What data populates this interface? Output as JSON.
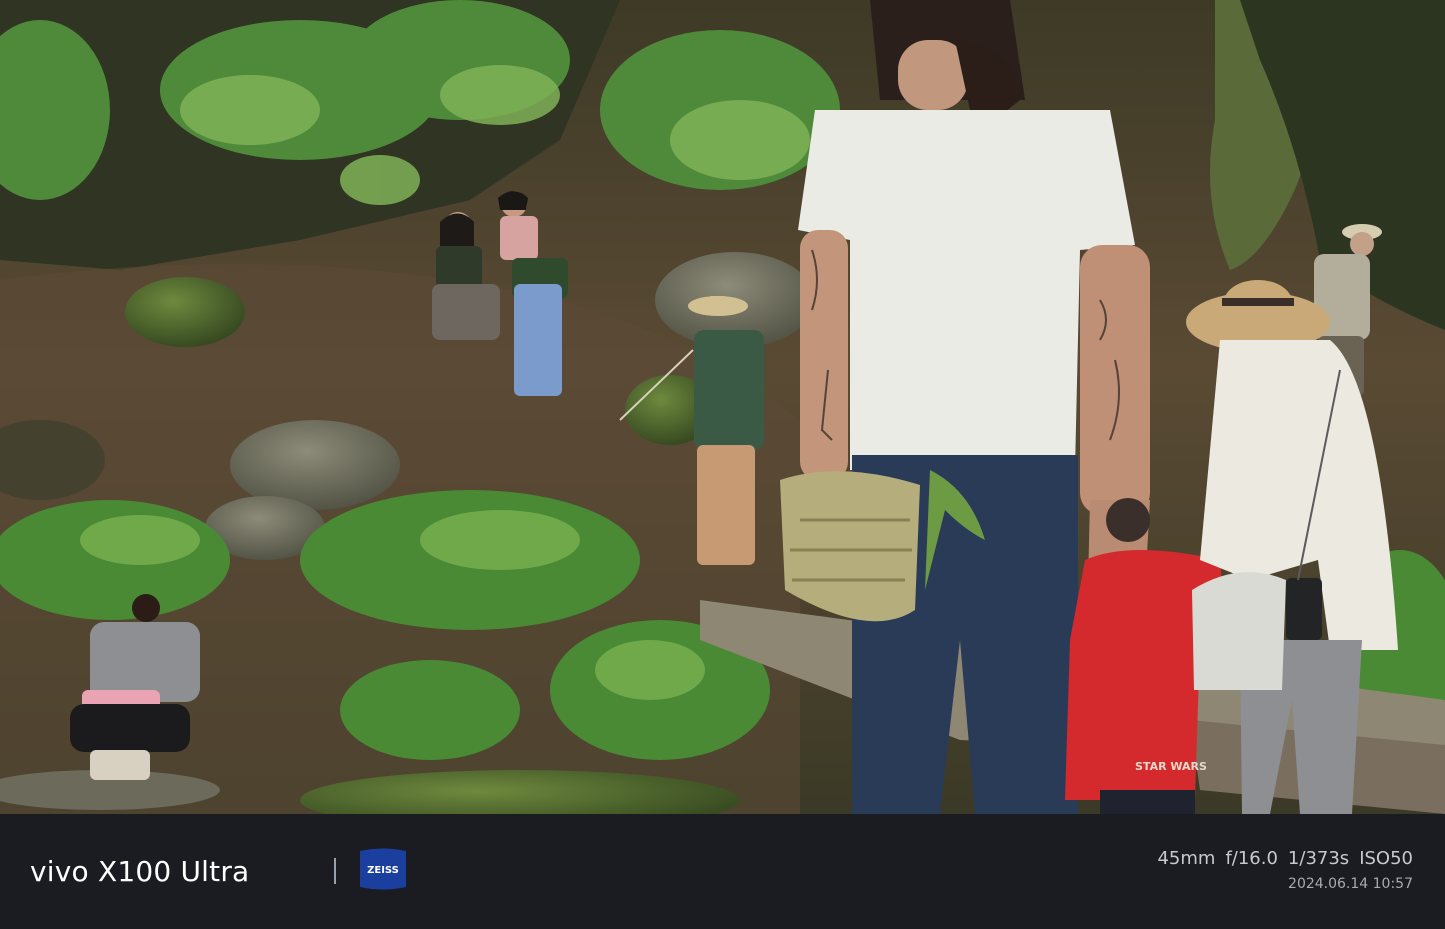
{
  "footer": {
    "brand": "vivo X100 Ultra",
    "partner_logo": {
      "text": "ZEISS",
      "color": "#1b3f9e"
    },
    "exif": {
      "focal_length": "45mm",
      "aperture": "f/16.0",
      "shutter": "1/373s",
      "iso": "ISO50"
    },
    "datetime": "2024.06.14 10:57",
    "background_color": "#1a1c22"
  },
  "photo": {
    "text_on_jacket": "STAR WARS"
  }
}
